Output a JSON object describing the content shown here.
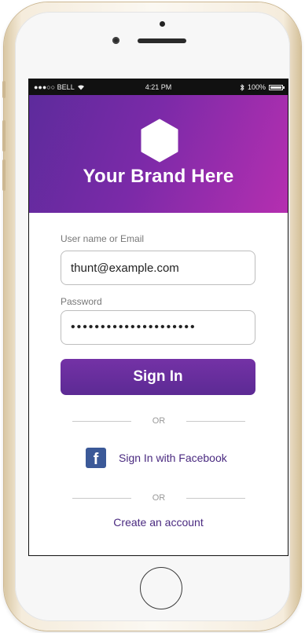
{
  "statusbar": {
    "carrier": "●●●○○ BELL",
    "time": "4:21 PM",
    "battery": "100%",
    "icons": [
      "signal-dots-icon",
      "wifi-icon",
      "bluetooth-icon",
      "battery-icon"
    ]
  },
  "header": {
    "brand": "Your Brand Here",
    "logo": "hexagon-logo-icon"
  },
  "form": {
    "username_label": "User name or Email",
    "username_value": "thunt@example.com",
    "password_label": "Password",
    "password_value": "•••••••••••••••••••••"
  },
  "actions": {
    "signin_label": "Sign In",
    "or_1": "OR",
    "facebook_label": "Sign In with Facebook",
    "facebook_icon": "facebook-icon",
    "or_2": "OR",
    "create_account": "Create an account"
  },
  "colors": {
    "header_start": "#5d2b9c",
    "header_end": "#b52fb0",
    "button": "#6a2f9f",
    "link": "#4a2a80",
    "facebook": "#3b5998"
  }
}
